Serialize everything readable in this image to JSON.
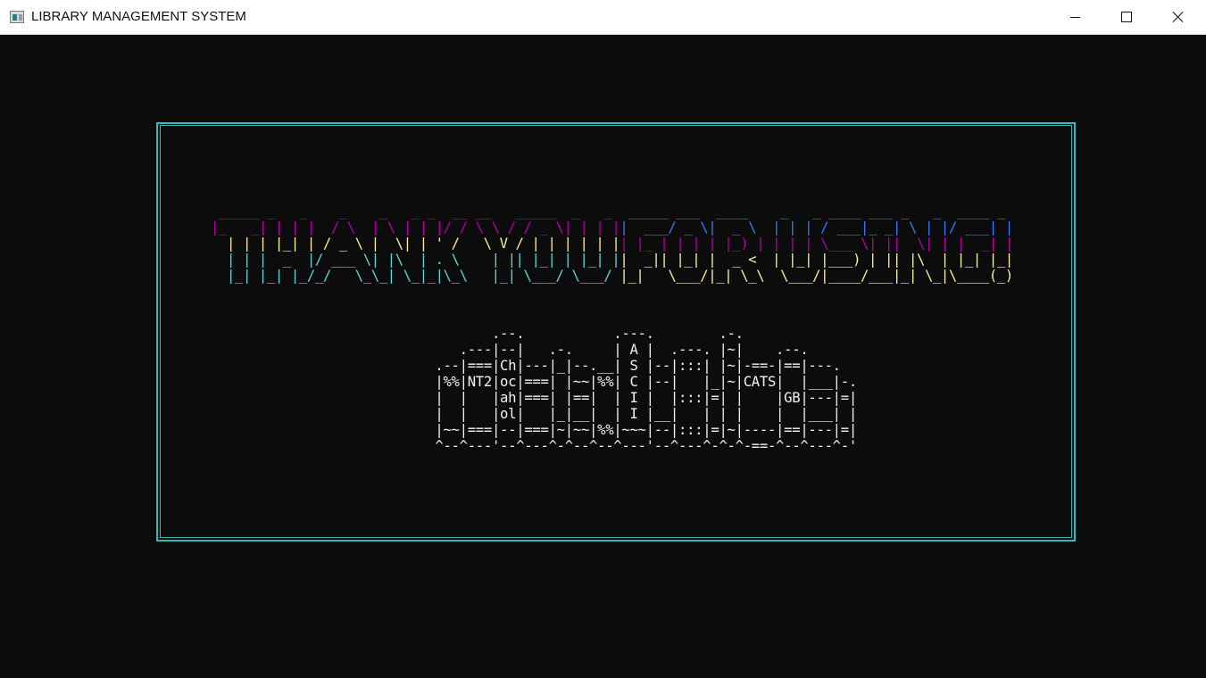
{
  "window": {
    "title": "LIBRARY MANAGEMENT SYSTEM",
    "controls": [
      "minimize",
      "maximize",
      "close"
    ]
  },
  "colors": {
    "background": "#0c0c0c",
    "frame": "#3ab7b7",
    "magenta": "#b4009e",
    "blue": "#3b78ff",
    "yellow": "#f9f1a5",
    "cyan": "#61d6d6",
    "text": "#f2f2f2"
  },
  "banner": {
    "text": "THANK YOU FOR USING!",
    "lines": [
      [
        {
          "color": "magenta",
          "text": " _____ _   _    _    _   _ _  __ __   _____  _   _ "
        },
        {
          "color": "blue",
          "text": " _____ ___  ____    _   _ ____ ___ _   _  ____ _ "
        }
      ],
      [
        {
          "color": "magenta",
          "text": "|_   _| | | |  / \\  | \\ | | |/ / \\ \\ / / _ \\| | | |"
        },
        {
          "color": "blue",
          "text": "|  ___/ _ \\|  _ \\  | | | / ___|_ _| \\ | |/ ___| |"
        }
      ],
      [
        {
          "color": "yellow",
          "text": "  | | | |_| | / _ \\ |  \\| | ' /   \\ V / | | | | | |"
        },
        {
          "color": "magenta",
          "text": "| |_ | | | | |_) | | | | \\___ \\| ||  \\| | |  _| |"
        }
      ],
      [
        {
          "color": "cyan",
          "text": "  | | |  _  |/ ___ \\| |\\  | . \\    | || |_| | |_| |"
        },
        {
          "color": "yellow",
          "text": "|  _|| |_| |  _ <  | |_| |___) | || |\\  | |_| |_|"
        }
      ],
      [
        {
          "color": "cyan",
          "text": "  |_| |_| |_/_/   \\_\\_| \\_|_|\\_\\   |_| \\___/ \\___/ "
        },
        {
          "color": "yellow",
          "text": "|_|   \\___/|_| \\_\\  \\___/|____/___|_| \\_|\\____(_)"
        }
      ]
    ]
  },
  "ascii_art": {
    "lines": [
      "           .--.           .---.        .-.",
      "       .---|--|   .-.     | A |  .---. |~|    .--.",
      "    .--|===|Ch|---|_|--.__| S |--|:::| |~|-==-|==|---.",
      "    |%%|NT2|oc|===| |~~|%%| C |--|   |_|~|CATS|  |___|-.",
      "    |  |   |ah|===| |==|  | I |  |:::|=| |    |GB|---|=|",
      "    |  |   |ol|   |_|__|  | I |__|   | | |    |  |___| |",
      "    |~~|===|--|===|~|~~|%%|~~~|--|:::|=|~|----|==|---|=|",
      "    ^--^---'--^---^-^--^--^---'--^---^-^-^-==-^--^---^-'"
    ]
  }
}
